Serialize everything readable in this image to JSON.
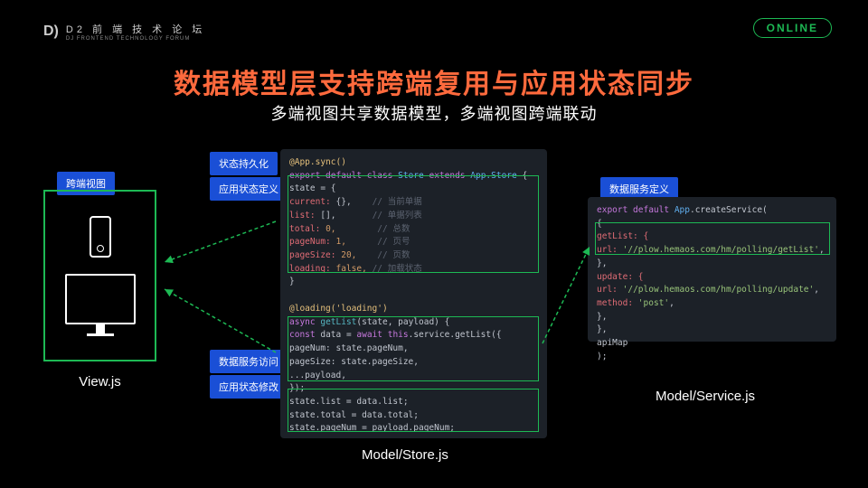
{
  "logo": {
    "icon": "D)",
    "cn": "D2 前 端 技 术 论 坛",
    "en": "DJ FRONTEND TECHNOLOGY FORUM"
  },
  "online": "ONLINE",
  "title": "数据模型层支持跨端复用与应用状态同步",
  "subtitle": "多端视图共享数据模型，多端视图跨端联动",
  "tags": {
    "cross_view": "跨端视图",
    "state_persist": "状态持久化",
    "app_state_def": "应用状态定义",
    "service_access": "数据服务访问",
    "app_state_mod": "应用状态修改",
    "service_def": "数据服务定义"
  },
  "labels": {
    "view": "View.js",
    "store": "Model/Store.js",
    "service": "Model/Service.js"
  },
  "code": {
    "store": {
      "l1_dec": "@App.sync()",
      "l2a": "export default class",
      "l2b": "Store",
      "l2c": "extends",
      "l2d": "App.Store",
      "l2e": "{",
      "l3": "  state = {",
      "l4a": "    current:",
      "l4b": "{},",
      "l4c": "// 当前单据",
      "l5a": "    list:",
      "l5b": "[],",
      "l5c": "// 单据列表",
      "l6a": "    total:",
      "l6b": "0,",
      "l6c": "// 总数",
      "l7a": "    pageNum:",
      "l7b": "1,",
      "l7c": "// 页号",
      "l8a": "    pageSize:",
      "l8b": "20,",
      "l8c": "// 页数",
      "l9a": "    loading:",
      "l9b": "false,",
      "l9c": "// 加载状态",
      "l10": "  }",
      "l11_dec": "@loading('loading')",
      "l12a": "async",
      "l12b": "getList",
      "l12c": "(state, payload) {",
      "l13a": "  const",
      "l13b": "data =",
      "l13c": "await this",
      "l13d": ".service.getList({",
      "l14": "    pageNum: state.pageNum,",
      "l15": "    pageSize: state.pageSize,",
      "l16": "    ...payload,",
      "l17": "  });",
      "l18": "  state.list = data.list;",
      "l19": "  state.total = data.total;",
      "l20": "  state.pageNum = payload.pageNum;"
    },
    "service": {
      "l1a": "export default",
      "l1b": "App",
      "l1c": ".createService(",
      "l2": "  {",
      "l3": "    getList: {",
      "l4a": "      url:",
      "l4b": "'//plow.hemaos.com/hm/polling/getList'",
      "l4c": ",",
      "l5": "    },",
      "l6": "    update: {",
      "l7a": "      url:",
      "l7b": "'//plow.hemaos.com/hm/polling/update'",
      "l7c": ",",
      "l8a": "      method:",
      "l8b": "'post'",
      "l8c": ",",
      "l9": "    },",
      "l10": "  },",
      "l11": "  apiMap",
      "l12": ");"
    }
  }
}
